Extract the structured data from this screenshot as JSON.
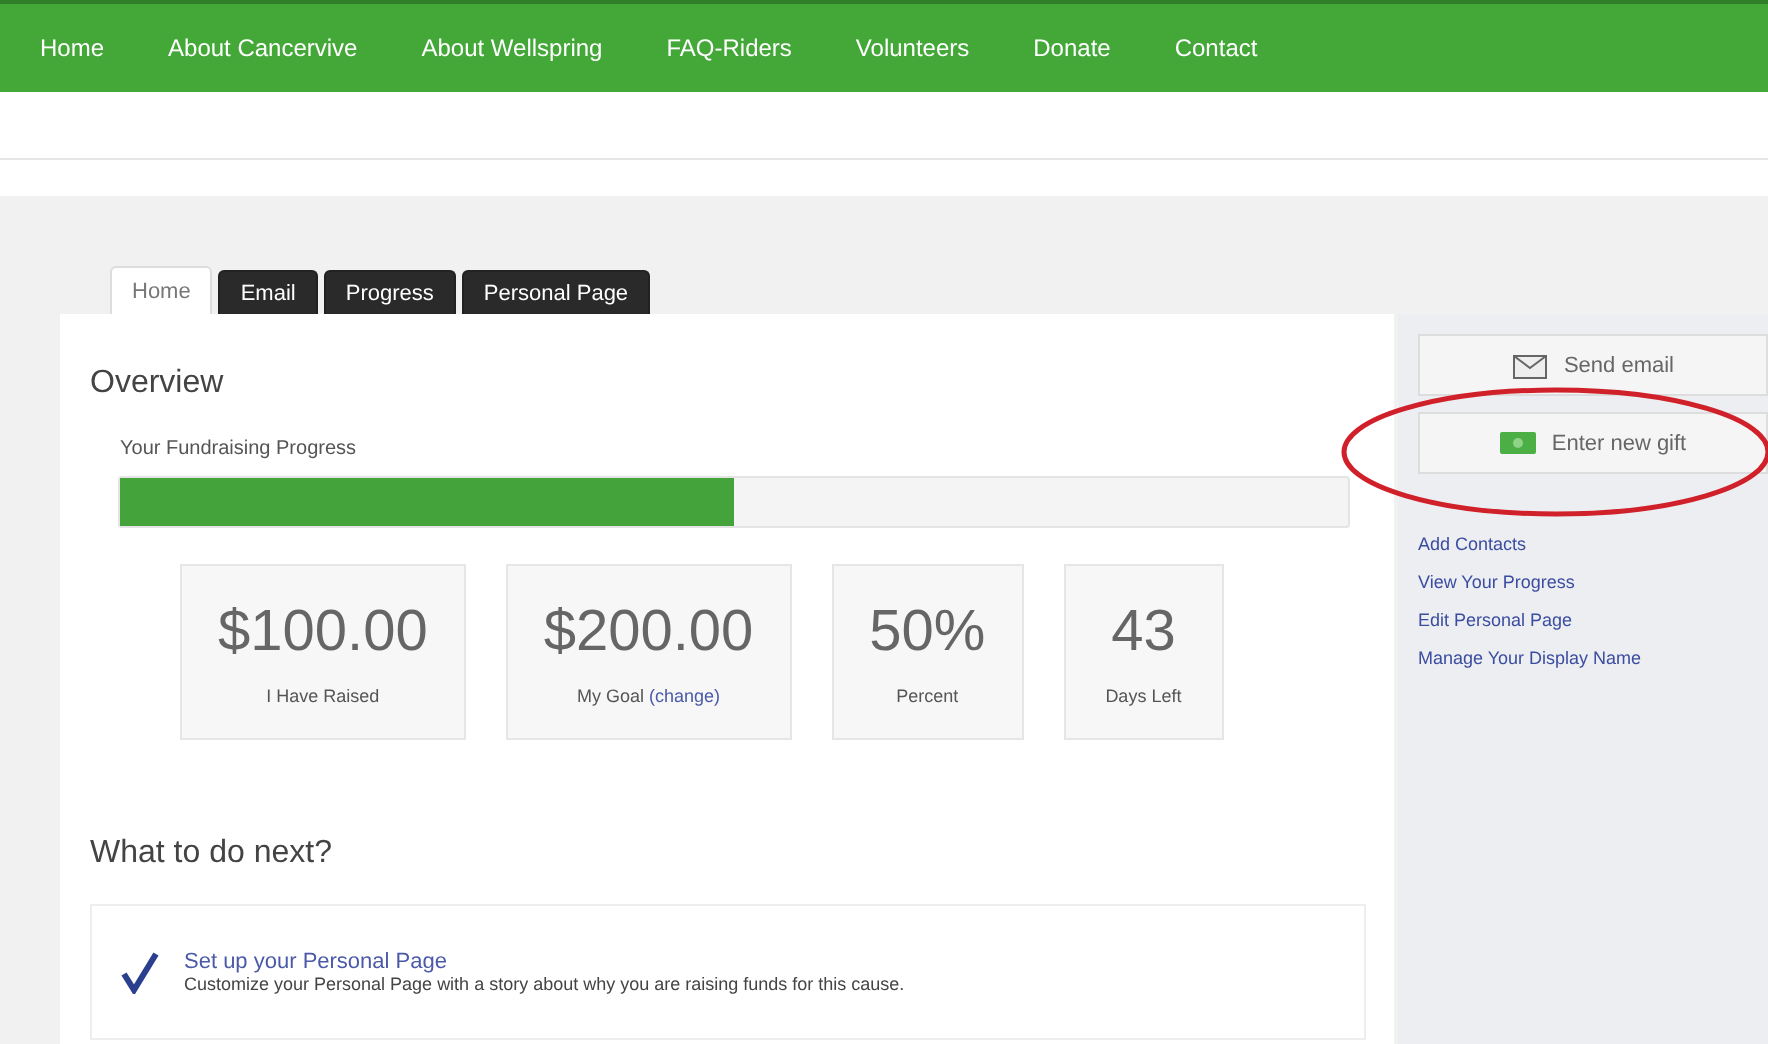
{
  "nav": [
    {
      "label": "Home"
    },
    {
      "label": "About Cancervive"
    },
    {
      "label": "About Wellspring"
    },
    {
      "label": "FAQ-Riders"
    },
    {
      "label": "Volunteers"
    },
    {
      "label": "Donate"
    },
    {
      "label": "Contact"
    }
  ],
  "tabs": [
    {
      "label": "Home",
      "selected": true
    },
    {
      "label": "Email",
      "selected": false
    },
    {
      "label": "Progress",
      "selected": false
    },
    {
      "label": "Personal Page",
      "selected": false
    }
  ],
  "overview": {
    "title": "Overview",
    "progress_label": "Your Fundraising Progress",
    "level": 0.5
  },
  "stats": [
    {
      "value": "$100.00",
      "label": "I Have Raised"
    },
    {
      "value": "$200.00",
      "label": "My Goal",
      "link": "(change)"
    },
    {
      "value": "50%",
      "label": "Percent"
    },
    {
      "value": "43",
      "label": "Days Left"
    }
  ],
  "next": {
    "title": "What to do next?",
    "items": [
      {
        "title": "Set up your Personal Page",
        "text": "Customize your Personal Page with a story about why you are raising funds for this cause.",
        "done": true
      }
    ]
  },
  "sidebar": {
    "buttons": [
      {
        "kind": "email",
        "label": "Send email",
        "circled": false
      },
      {
        "kind": "gift",
        "label": "Enter new gift",
        "circled": true
      }
    ],
    "links": [
      "Add Contacts",
      "View Your Progress",
      "Edit Personal Page",
      "Manage Your Display Name"
    ]
  }
}
